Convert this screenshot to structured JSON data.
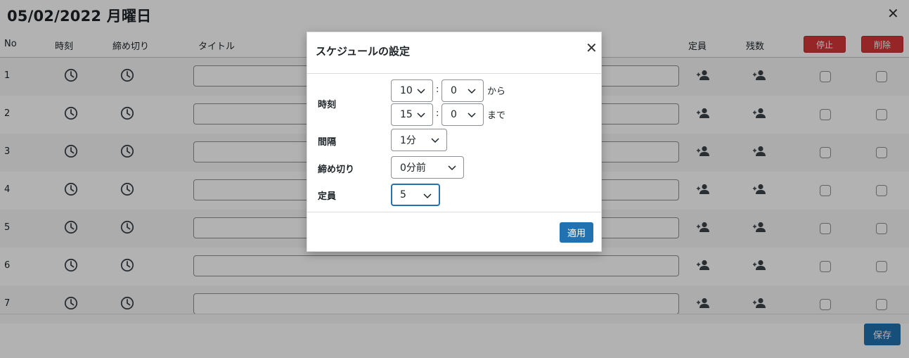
{
  "page": {
    "title": "05/02/2022 月曜日",
    "close_glyph": "✕",
    "save_label": "保存"
  },
  "table": {
    "headers": {
      "no": "No",
      "time": "時刻",
      "deadline": "締め切り",
      "title": "タイトル",
      "capacity": "定員",
      "remaining": "残数",
      "stop": "停止",
      "delete": "削除"
    },
    "rows": [
      {
        "no": "1"
      },
      {
        "no": "2"
      },
      {
        "no": "3"
      },
      {
        "no": "4"
      },
      {
        "no": "5"
      },
      {
        "no": "6"
      },
      {
        "no": "7"
      }
    ]
  },
  "modal": {
    "title": "スケジュールの設定",
    "close_glyph": "✕",
    "time_label": "時刻",
    "start_hour": "10",
    "start_minute": "0",
    "from_suffix": "から",
    "end_hour": "15",
    "end_minute": "0",
    "to_suffix": "まで",
    "colon": ":",
    "interval_label": "間隔",
    "interval_value": "1分",
    "deadline_label": "締め切り",
    "deadline_value": "0分前",
    "capacity_label": "定員",
    "capacity_value": "5",
    "apply_label": "適用"
  },
  "colors": {
    "primary": "#2271b1",
    "danger": "#d63638"
  }
}
